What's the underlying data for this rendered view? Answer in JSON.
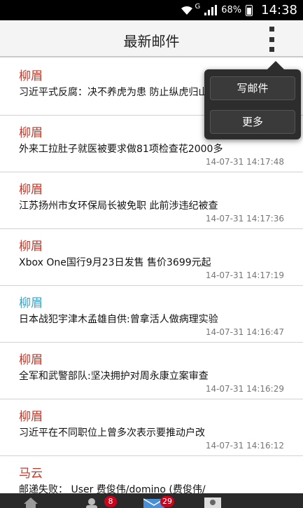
{
  "status_bar": {
    "network_type": "G",
    "battery": "68%",
    "battery_level": 0.68,
    "time": "14:38"
  },
  "header": {
    "title": "最新邮件"
  },
  "popup_menu": {
    "items": [
      "写邮件",
      "更多"
    ]
  },
  "mails": [
    {
      "sender": "柳眉",
      "subject": "习近平式反腐：决不养虎为患 防止纵虎归山",
      "time": "",
      "read": false
    },
    {
      "sender": "柳眉",
      "subject": "外来工拉肚子就医被要求做81项检查花2000多",
      "time": "14-07-31 14:17:48",
      "read": false
    },
    {
      "sender": "柳眉",
      "subject": "江苏扬州市女环保局长被免职 此前涉违纪被查",
      "time": "14-07-31 14:17:36",
      "read": false
    },
    {
      "sender": "柳眉",
      "subject": "Xbox One国行9月23日发售 售价3699元起",
      "time": "14-07-31 14:17:19",
      "read": false
    },
    {
      "sender": "柳眉",
      "subject": "日本战犯宇津木孟雄自供:曾拿活人做病理实验",
      "time": "14-07-31 14:16:47",
      "read": true
    },
    {
      "sender": "柳眉",
      "subject": "全军和武警部队:坚决拥护对周永康立案审查",
      "time": "14-07-31 14:16:29",
      "read": false
    },
    {
      "sender": "柳眉",
      "subject": "习近平在不同职位上曾多次表示要推动户改",
      "time": "14-07-31 14:16:12",
      "read": false
    },
    {
      "sender": "马云",
      "subject": "邮递失败： User 费俊伟/domino (费俊伟/",
      "time": "",
      "read": false
    }
  ],
  "bottom_nav": {
    "contacts_badge": "8",
    "mail_badge": "29"
  }
}
